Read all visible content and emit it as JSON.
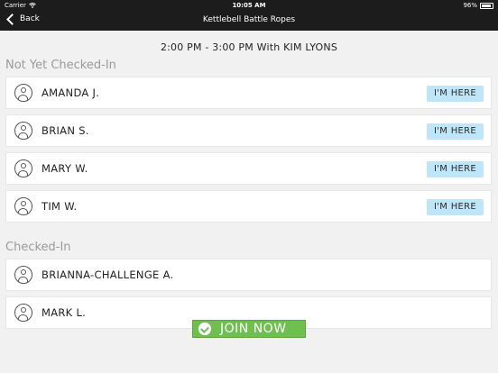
{
  "status_bar": {
    "carrier": "Carrier",
    "time": "10:05 AM",
    "battery": "96%"
  },
  "nav": {
    "back_label": "Back",
    "title": "Kettlebell Battle Ropes"
  },
  "session": {
    "info": "2:00 PM - 3:00 PM With KIM LYONS"
  },
  "not_checked_in": {
    "header": "Not Yet Checked-In",
    "button_label": "I'M HERE",
    "members": [
      {
        "name": "AMANDA J."
      },
      {
        "name": "BRIAN S."
      },
      {
        "name": "MARY W."
      },
      {
        "name": "TIM W."
      }
    ]
  },
  "checked_in": {
    "header": "Checked-In",
    "members": [
      {
        "name": "BRIANNA-CHALLENGE A."
      },
      {
        "name": "MARK L."
      }
    ]
  },
  "join": {
    "label": "JOIN NOW"
  },
  "icons": {
    "wifi": "wifi-icon",
    "battery": "battery-icon",
    "back": "chevron-left-icon",
    "avatar": "user-avatar-icon",
    "check": "check-circle-icon"
  },
  "colors": {
    "bar": "#1c1c1c",
    "imhere_button": "#bfe6f8",
    "join_button": "#6fbf4f",
    "section_header": "#9a9a9a"
  }
}
